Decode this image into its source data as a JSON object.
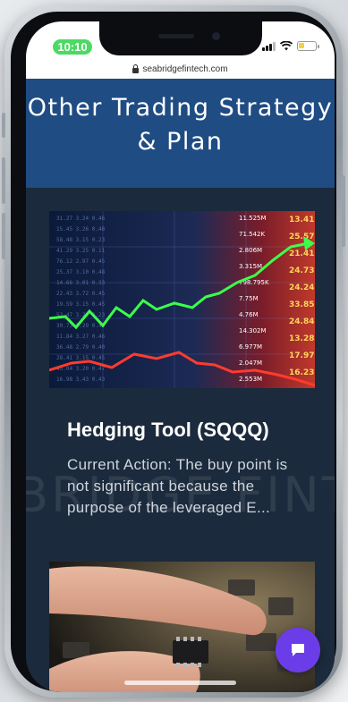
{
  "status_bar": {
    "time": "10:10"
  },
  "browser": {
    "url": "seabridgefintech.com"
  },
  "header": {
    "title": "Other Trading Strategy & Plan"
  },
  "watermark": "BRIDGE FINT",
  "cards": [
    {
      "title": "Hedging Tool (SQQQ)",
      "description": "Current Action: The buy point is not significant because the purpose of the leveraged E...",
      "image_numbers": [
        "13.41",
        "25.57",
        "21.41",
        "24.73",
        "24.24",
        "33.85",
        "24.84",
        "13.28",
        "17.97",
        "16.23",
        "11.525M",
        "71.542K",
        "2.806M",
        "3.315M",
        "798.795K",
        "7.75M",
        "4.76M",
        "14.302M",
        "6.977M",
        "2.047M",
        "2.553M"
      ]
    },
    {
      "title": "",
      "description": ""
    }
  ],
  "colors": {
    "header": "#1f4c83",
    "content_bg": "#1b2a3c",
    "chat_button": "#6a3de8",
    "time_pill": "#4cd964"
  }
}
